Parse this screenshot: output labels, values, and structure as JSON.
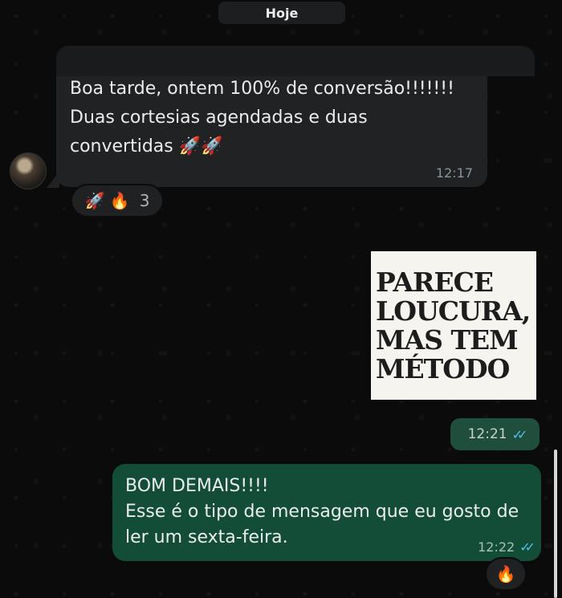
{
  "date_label": "Hoje",
  "incoming": {
    "text": "Boa tarde, ontem 100% de conversão!!!!!!! Duas cortesias agendadas e duas convertidas 🚀🚀",
    "time": "12:17",
    "reactions": {
      "emoji": "🚀 🔥",
      "count": "3"
    }
  },
  "image": {
    "lines": [
      "PARECE",
      "LOUCURA,",
      "MAS TEM",
      "MÉTODO"
    ],
    "time": "12:21",
    "status": "read"
  },
  "outgoing": {
    "line1": "BOM DEMAIS!!!!",
    "line2": "Esse é o tipo de mensagem que eu gosto de ler um sexta-feira.",
    "time": "12:22",
    "status": "read",
    "reaction": "🔥"
  },
  "colors": {
    "background": "#0b0b0b",
    "incoming_bubble": "#202224",
    "outgoing_bubble": "#144d37",
    "read_ticks": "#53bdeb"
  },
  "icons": {
    "read_receipt": "double-check-icon"
  }
}
